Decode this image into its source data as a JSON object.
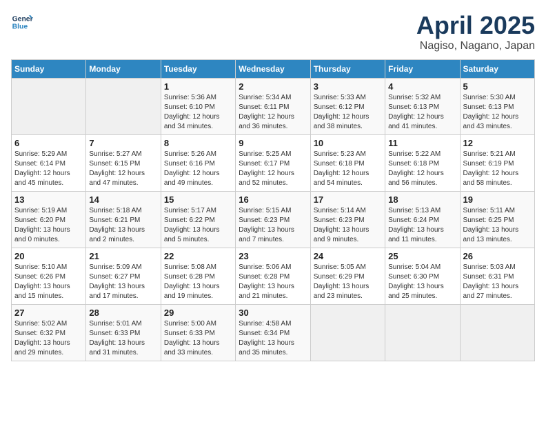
{
  "logo": {
    "line1": "General",
    "line2": "Blue"
  },
  "title": "April 2025",
  "subtitle": "Nagiso, Nagano, Japan",
  "weekdays": [
    "Sunday",
    "Monday",
    "Tuesday",
    "Wednesday",
    "Thursday",
    "Friday",
    "Saturday"
  ],
  "weeks": [
    [
      {
        "day": "",
        "sunrise": "",
        "sunset": "",
        "daylight": ""
      },
      {
        "day": "",
        "sunrise": "",
        "sunset": "",
        "daylight": ""
      },
      {
        "day": "1",
        "sunrise": "Sunrise: 5:36 AM",
        "sunset": "Sunset: 6:10 PM",
        "daylight": "Daylight: 12 hours and 34 minutes."
      },
      {
        "day": "2",
        "sunrise": "Sunrise: 5:34 AM",
        "sunset": "Sunset: 6:11 PM",
        "daylight": "Daylight: 12 hours and 36 minutes."
      },
      {
        "day": "3",
        "sunrise": "Sunrise: 5:33 AM",
        "sunset": "Sunset: 6:12 PM",
        "daylight": "Daylight: 12 hours and 38 minutes."
      },
      {
        "day": "4",
        "sunrise": "Sunrise: 5:32 AM",
        "sunset": "Sunset: 6:13 PM",
        "daylight": "Daylight: 12 hours and 41 minutes."
      },
      {
        "day": "5",
        "sunrise": "Sunrise: 5:30 AM",
        "sunset": "Sunset: 6:13 PM",
        "daylight": "Daylight: 12 hours and 43 minutes."
      }
    ],
    [
      {
        "day": "6",
        "sunrise": "Sunrise: 5:29 AM",
        "sunset": "Sunset: 6:14 PM",
        "daylight": "Daylight: 12 hours and 45 minutes."
      },
      {
        "day": "7",
        "sunrise": "Sunrise: 5:27 AM",
        "sunset": "Sunset: 6:15 PM",
        "daylight": "Daylight: 12 hours and 47 minutes."
      },
      {
        "day": "8",
        "sunrise": "Sunrise: 5:26 AM",
        "sunset": "Sunset: 6:16 PM",
        "daylight": "Daylight: 12 hours and 49 minutes."
      },
      {
        "day": "9",
        "sunrise": "Sunrise: 5:25 AM",
        "sunset": "Sunset: 6:17 PM",
        "daylight": "Daylight: 12 hours and 52 minutes."
      },
      {
        "day": "10",
        "sunrise": "Sunrise: 5:23 AM",
        "sunset": "Sunset: 6:18 PM",
        "daylight": "Daylight: 12 hours and 54 minutes."
      },
      {
        "day": "11",
        "sunrise": "Sunrise: 5:22 AM",
        "sunset": "Sunset: 6:18 PM",
        "daylight": "Daylight: 12 hours and 56 minutes."
      },
      {
        "day": "12",
        "sunrise": "Sunrise: 5:21 AM",
        "sunset": "Sunset: 6:19 PM",
        "daylight": "Daylight: 12 hours and 58 minutes."
      }
    ],
    [
      {
        "day": "13",
        "sunrise": "Sunrise: 5:19 AM",
        "sunset": "Sunset: 6:20 PM",
        "daylight": "Daylight: 13 hours and 0 minutes."
      },
      {
        "day": "14",
        "sunrise": "Sunrise: 5:18 AM",
        "sunset": "Sunset: 6:21 PM",
        "daylight": "Daylight: 13 hours and 2 minutes."
      },
      {
        "day": "15",
        "sunrise": "Sunrise: 5:17 AM",
        "sunset": "Sunset: 6:22 PM",
        "daylight": "Daylight: 13 hours and 5 minutes."
      },
      {
        "day": "16",
        "sunrise": "Sunrise: 5:15 AM",
        "sunset": "Sunset: 6:23 PM",
        "daylight": "Daylight: 13 hours and 7 minutes."
      },
      {
        "day": "17",
        "sunrise": "Sunrise: 5:14 AM",
        "sunset": "Sunset: 6:23 PM",
        "daylight": "Daylight: 13 hours and 9 minutes."
      },
      {
        "day": "18",
        "sunrise": "Sunrise: 5:13 AM",
        "sunset": "Sunset: 6:24 PM",
        "daylight": "Daylight: 13 hours and 11 minutes."
      },
      {
        "day": "19",
        "sunrise": "Sunrise: 5:11 AM",
        "sunset": "Sunset: 6:25 PM",
        "daylight": "Daylight: 13 hours and 13 minutes."
      }
    ],
    [
      {
        "day": "20",
        "sunrise": "Sunrise: 5:10 AM",
        "sunset": "Sunset: 6:26 PM",
        "daylight": "Daylight: 13 hours and 15 minutes."
      },
      {
        "day": "21",
        "sunrise": "Sunrise: 5:09 AM",
        "sunset": "Sunset: 6:27 PM",
        "daylight": "Daylight: 13 hours and 17 minutes."
      },
      {
        "day": "22",
        "sunrise": "Sunrise: 5:08 AM",
        "sunset": "Sunset: 6:28 PM",
        "daylight": "Daylight: 13 hours and 19 minutes."
      },
      {
        "day": "23",
        "sunrise": "Sunrise: 5:06 AM",
        "sunset": "Sunset: 6:28 PM",
        "daylight": "Daylight: 13 hours and 21 minutes."
      },
      {
        "day": "24",
        "sunrise": "Sunrise: 5:05 AM",
        "sunset": "Sunset: 6:29 PM",
        "daylight": "Daylight: 13 hours and 23 minutes."
      },
      {
        "day": "25",
        "sunrise": "Sunrise: 5:04 AM",
        "sunset": "Sunset: 6:30 PM",
        "daylight": "Daylight: 13 hours and 25 minutes."
      },
      {
        "day": "26",
        "sunrise": "Sunrise: 5:03 AM",
        "sunset": "Sunset: 6:31 PM",
        "daylight": "Daylight: 13 hours and 27 minutes."
      }
    ],
    [
      {
        "day": "27",
        "sunrise": "Sunrise: 5:02 AM",
        "sunset": "Sunset: 6:32 PM",
        "daylight": "Daylight: 13 hours and 29 minutes."
      },
      {
        "day": "28",
        "sunrise": "Sunrise: 5:01 AM",
        "sunset": "Sunset: 6:33 PM",
        "daylight": "Daylight: 13 hours and 31 minutes."
      },
      {
        "day": "29",
        "sunrise": "Sunrise: 5:00 AM",
        "sunset": "Sunset: 6:33 PM",
        "daylight": "Daylight: 13 hours and 33 minutes."
      },
      {
        "day": "30",
        "sunrise": "Sunrise: 4:58 AM",
        "sunset": "Sunset: 6:34 PM",
        "daylight": "Daylight: 13 hours and 35 minutes."
      },
      {
        "day": "",
        "sunrise": "",
        "sunset": "",
        "daylight": ""
      },
      {
        "day": "",
        "sunrise": "",
        "sunset": "",
        "daylight": ""
      },
      {
        "day": "",
        "sunrise": "",
        "sunset": "",
        "daylight": ""
      }
    ]
  ]
}
